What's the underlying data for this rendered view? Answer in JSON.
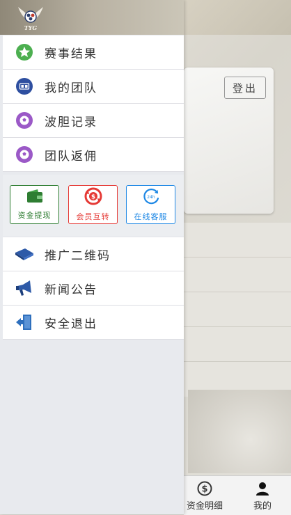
{
  "background": {
    "logout_label": "登出"
  },
  "bottom_nav": {
    "items": [
      {
        "label": "资金明细",
        "icon": "dollar-circle-icon"
      },
      {
        "label": "我的",
        "icon": "user-icon"
      }
    ]
  },
  "drawer": {
    "logo_text": "TYG",
    "menu_top": [
      {
        "label": "赛事结果",
        "icon": "star-icon",
        "color": "#4caf50"
      },
      {
        "label": "我的团队",
        "icon": "team-icon",
        "color": "#2e4fa0"
      },
      {
        "label": "波胆记录",
        "icon": "soccer-ball-icon",
        "color": "#9b59c7"
      },
      {
        "label": "团队返佣",
        "icon": "soccer-ball-icon",
        "color": "#9b59c7"
      }
    ],
    "quick_actions": [
      {
        "label": "资金提现",
        "icon": "wallet-icon",
        "color": "#2e7d32"
      },
      {
        "label": "会员互转",
        "icon": "transfer-icon",
        "color": "#e53935"
      },
      {
        "label": "在线客服",
        "icon": "customer-service-icon",
        "color": "#1e88e5"
      }
    ],
    "menu_bottom": [
      {
        "label": "推广二维码",
        "icon": "card-icon",
        "color": "#2e5aa8"
      },
      {
        "label": "新闻公告",
        "icon": "megaphone-icon",
        "color": "#2e5aa8"
      },
      {
        "label": "安全退出",
        "icon": "exit-door-icon",
        "color": "#2e6fbd"
      }
    ]
  }
}
